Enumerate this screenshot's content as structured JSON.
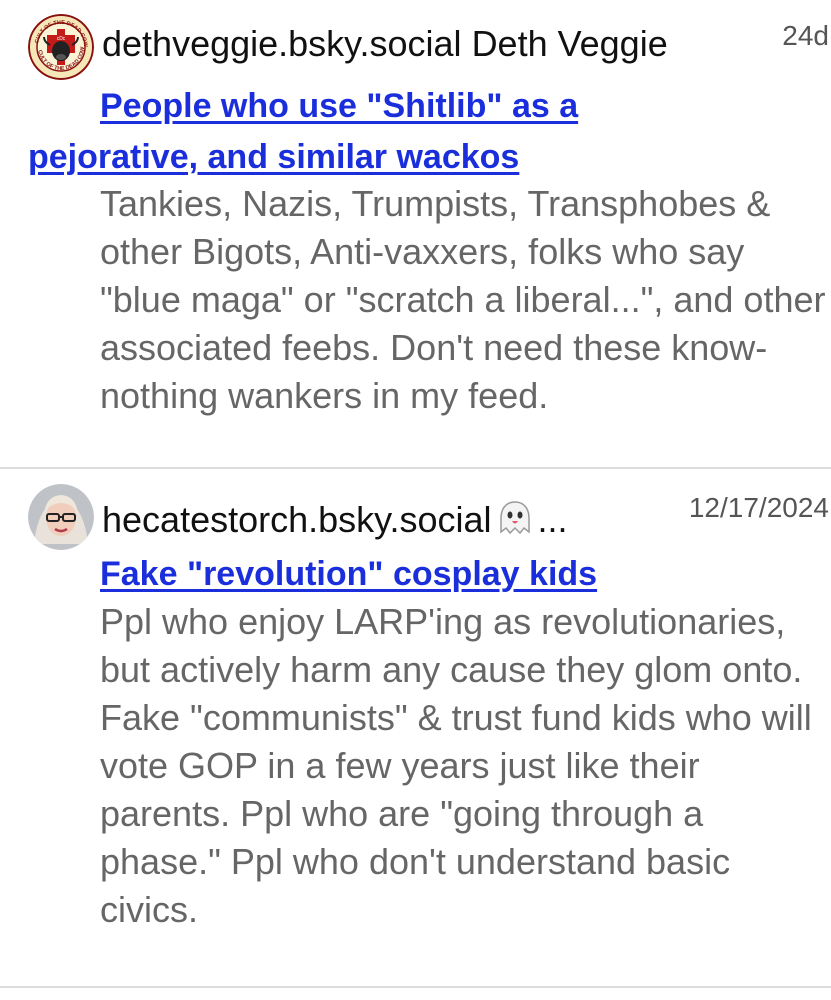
{
  "entries": [
    {
      "handle": "dethveggie.bsky.social",
      "display_name": "Deth Veggie",
      "time": "24d",
      "avatar_icon": "cult-of-the-dead-cow-logo",
      "avatar_logo_text": "CULT OF THE DEAD COW",
      "title": "People who use \"Shitlib\" as a pejorative, and similar wackos",
      "description": "Tankies, Nazis, Trumpists, Transphobes & other Bigots, Anti-vaxxers, folks who say \"blue maga\" or \"scratch a liberal...\", and other associated feebs. Don't need these know-nothing wankers in my feed."
    },
    {
      "handle": "hecatestorch.bsky.social",
      "display_name_icon": "ghost-emoji",
      "display_name_truncation": "...",
      "time": "12/17/2024",
      "avatar_icon": "user-photo",
      "title": "Fake \"revolution\" cosplay kids",
      "description": "Ppl who enjoy LARP'ing as revolutionaries, but actively harm any cause they glom onto. Fake \"communists\" & trust fund kids who will vote GOP in a few years just like their parents. Ppl who are \"going through a phase.\" Ppl who don't understand basic civics."
    }
  ],
  "colors": {
    "link": "#1a2fdb",
    "text": "#111111",
    "muted": "#666666",
    "divider": "#dcdcdc"
  }
}
